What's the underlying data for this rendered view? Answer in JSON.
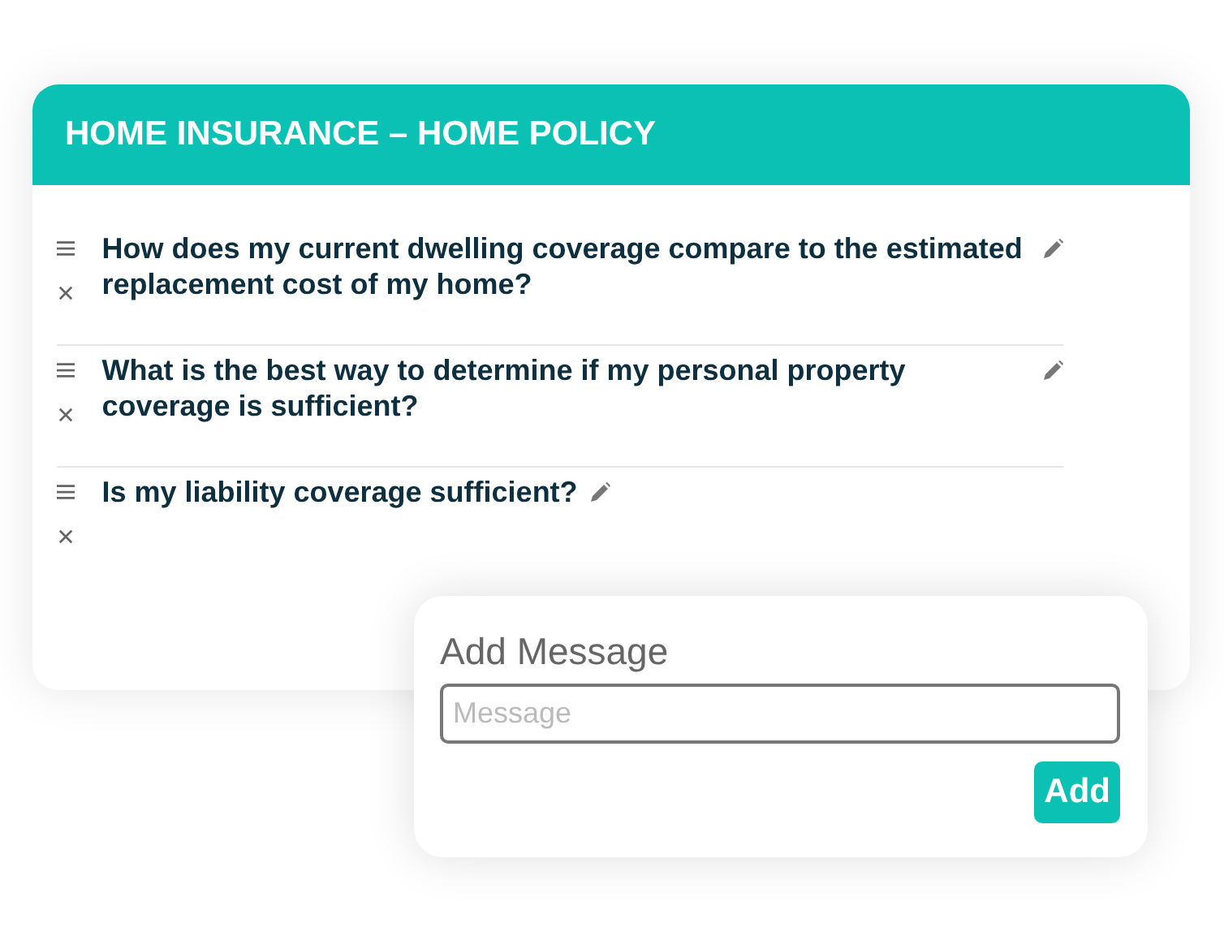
{
  "card": {
    "title": "HOME INSURANCE – HOME POLICY"
  },
  "questions": [
    {
      "text": "How does my current dwelling coverage compare to the estimated replacement cost of my home?"
    },
    {
      "text": "What is the best way to determine if my personal property coverage is sufficient?"
    },
    {
      "text": "Is my liability coverage sufficient?"
    }
  ],
  "dialog": {
    "title": "Add Message",
    "field": {
      "placeholder": "Message"
    },
    "button": "Add"
  }
}
